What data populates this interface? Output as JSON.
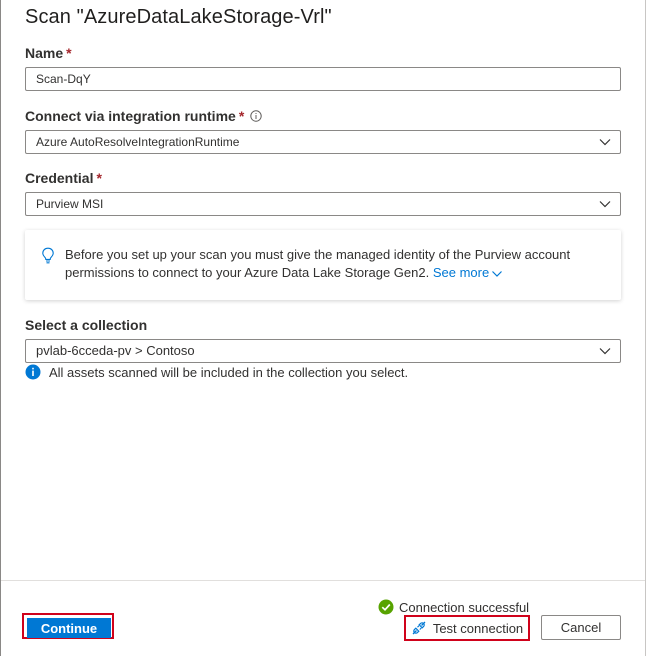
{
  "panel": {
    "title": "Scan \"AzureDataLakeStorage-Vrl\""
  },
  "form": {
    "name": {
      "label": "Name",
      "required_mark": "*",
      "value": "Scan-DqY"
    },
    "runtime": {
      "label": "Connect via integration runtime",
      "required_mark": "*",
      "info_icon": "info-outline-icon",
      "selected": "Azure AutoResolveIntegrationRuntime"
    },
    "credential": {
      "label": "Credential",
      "required_mark": "*",
      "selected": "Purview MSI"
    },
    "notice": {
      "icon": "lightbulb-icon",
      "text": "Before you set up your scan you must give the managed identity of the Purview account permissions to connect to your Azure Data Lake Storage Gen2.",
      "link": "See more"
    },
    "collection": {
      "label": "Select a collection",
      "selected": "pvlab-6cceda-pv > Contoso",
      "info_text": "All assets scanned will be included in the collection you select."
    }
  },
  "footer": {
    "continue_label": "Continue",
    "status_text": "Connection successful",
    "test_connection_label": "Test connection",
    "cancel_label": "Cancel"
  },
  "colors": {
    "accent": "#0078d4",
    "required": "#a4262c",
    "success": "#57a300",
    "highlight": "#d0021b"
  }
}
